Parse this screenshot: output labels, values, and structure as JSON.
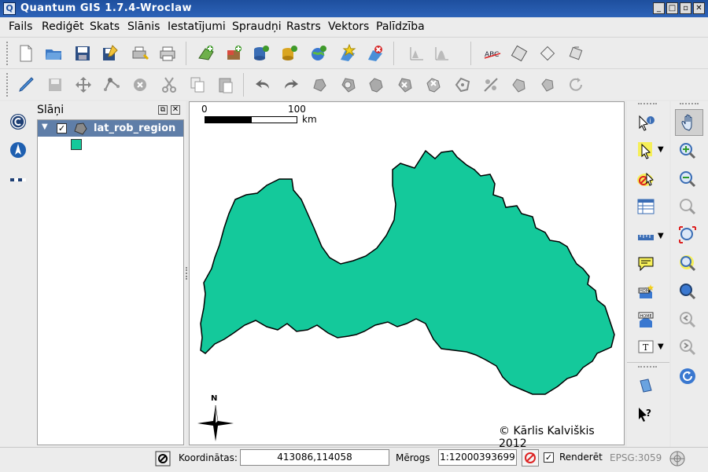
{
  "window": {
    "title": "Quantum GIS 1.7.4-Wroclaw",
    "app_icon": "Q",
    "controls": {
      "minimize": "_",
      "maximize": "□",
      "close": "✕"
    }
  },
  "menu": [
    "Fails",
    "Rediģēt",
    "Skats",
    "Slānis",
    "Iestatījumi",
    "Spraudņi",
    "Rastrs",
    "Vektors",
    "Palīdzība"
  ],
  "layers_panel": {
    "title": "Slāņi",
    "layers": [
      {
        "name": "lat_rob_region",
        "checked": true,
        "color": "#14c99b"
      }
    ]
  },
  "map": {
    "scalebar": {
      "start": "0",
      "end": "100",
      "unit": "km"
    },
    "north_label": "N",
    "copyright": "© Kārlis Kalviškis 2012",
    "fill_color": "#14c99b"
  },
  "statusbar": {
    "coord_label": "Koordinātas:",
    "coord_value": "413086,114058",
    "scale_label": "Mērogs",
    "scale_value": "1:12000393699",
    "render_label": "Renderēt",
    "render_checked": true,
    "crs": "EPSG:3059"
  }
}
